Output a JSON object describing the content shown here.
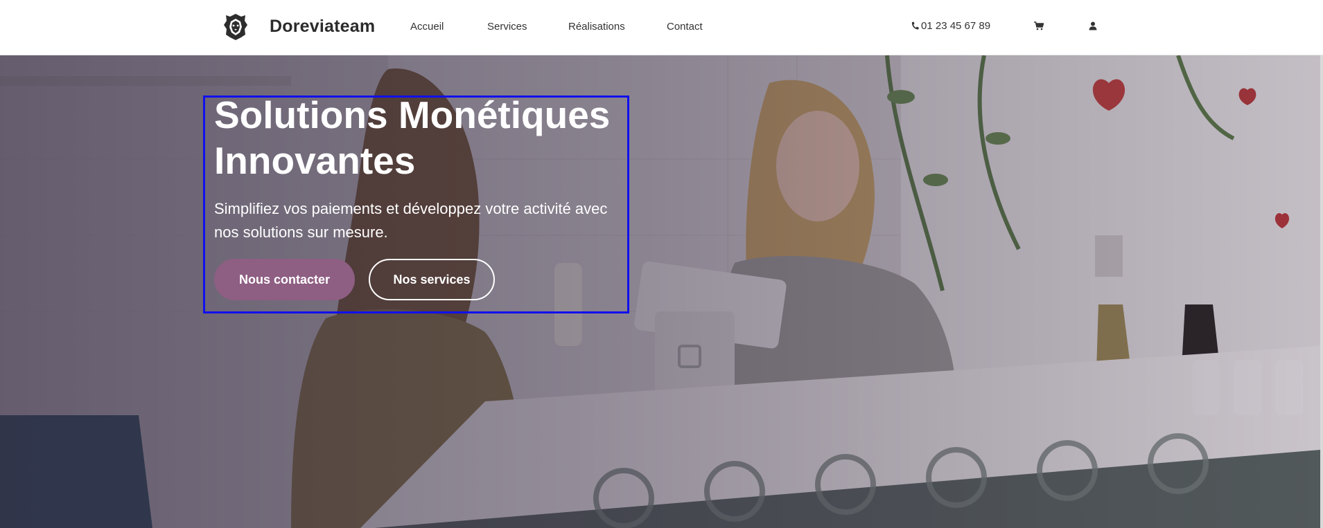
{
  "header": {
    "brand": "Doreviateam",
    "nav": [
      "Accueil",
      "Services",
      "Réalisations",
      "Contact"
    ],
    "phone": "01 23 45 67 89",
    "icons": [
      "lion-logo-icon",
      "phone-icon",
      "cart-icon",
      "user-icon"
    ]
  },
  "hero": {
    "title": "Solutions Monétiques Innovantes",
    "subtitle": "Simplifiez vos paiements et développez votre activité avec nos solutions sur mesure.",
    "primary_button": "Nous contacter",
    "secondary_button": "Nos services"
  },
  "colors": {
    "accent": "#8e5e83",
    "header_bg": "#ffffff",
    "selection_outline": "#1010ee"
  }
}
